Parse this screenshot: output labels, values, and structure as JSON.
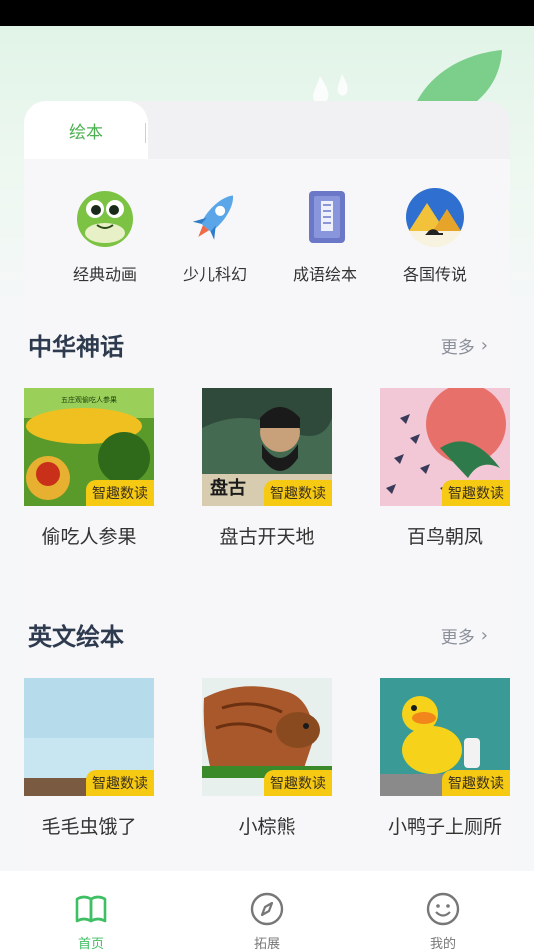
{
  "tabs": [
    {
      "label": "绘本",
      "active": true
    }
  ],
  "categories": [
    {
      "label": "经典动画",
      "icon": "frog-icon"
    },
    {
      "label": "少儿科幻",
      "icon": "rocket-icon"
    },
    {
      "label": "成语绘本",
      "icon": "book-icon"
    },
    {
      "label": "各国传说",
      "icon": "pyramid-icon"
    }
  ],
  "sections": [
    {
      "title": "中华神话",
      "more": "更多",
      "books": [
        {
          "title": "偷吃人参果",
          "badge": "智趣数读"
        },
        {
          "title": "盘古开天地",
          "badge": "智趣数读"
        },
        {
          "title": "百鸟朝凤",
          "badge": "智趣数读"
        }
      ]
    },
    {
      "title": "英文绘本",
      "more": "更多",
      "books": [
        {
          "title": "毛毛虫饿了",
          "badge": "智趣数读"
        },
        {
          "title": "小棕熊",
          "badge": "智趣数读"
        },
        {
          "title": "小鸭子上厕所",
          "badge": "智趣数读"
        }
      ]
    }
  ],
  "cover_texts": {
    "cover_1_top": "五庄观偷吃人参果",
    "cover_2": "盘古"
  },
  "nav": [
    {
      "label": "首页",
      "icon": "book-open-icon",
      "active": true
    },
    {
      "label": "拓展",
      "icon": "compass-icon",
      "active": false
    },
    {
      "label": "我的",
      "icon": "smiley-icon",
      "active": false
    }
  ],
  "colors": {
    "accent": "#4caf50",
    "badge": "#f6c913",
    "nav_active": "#3fbf63"
  }
}
